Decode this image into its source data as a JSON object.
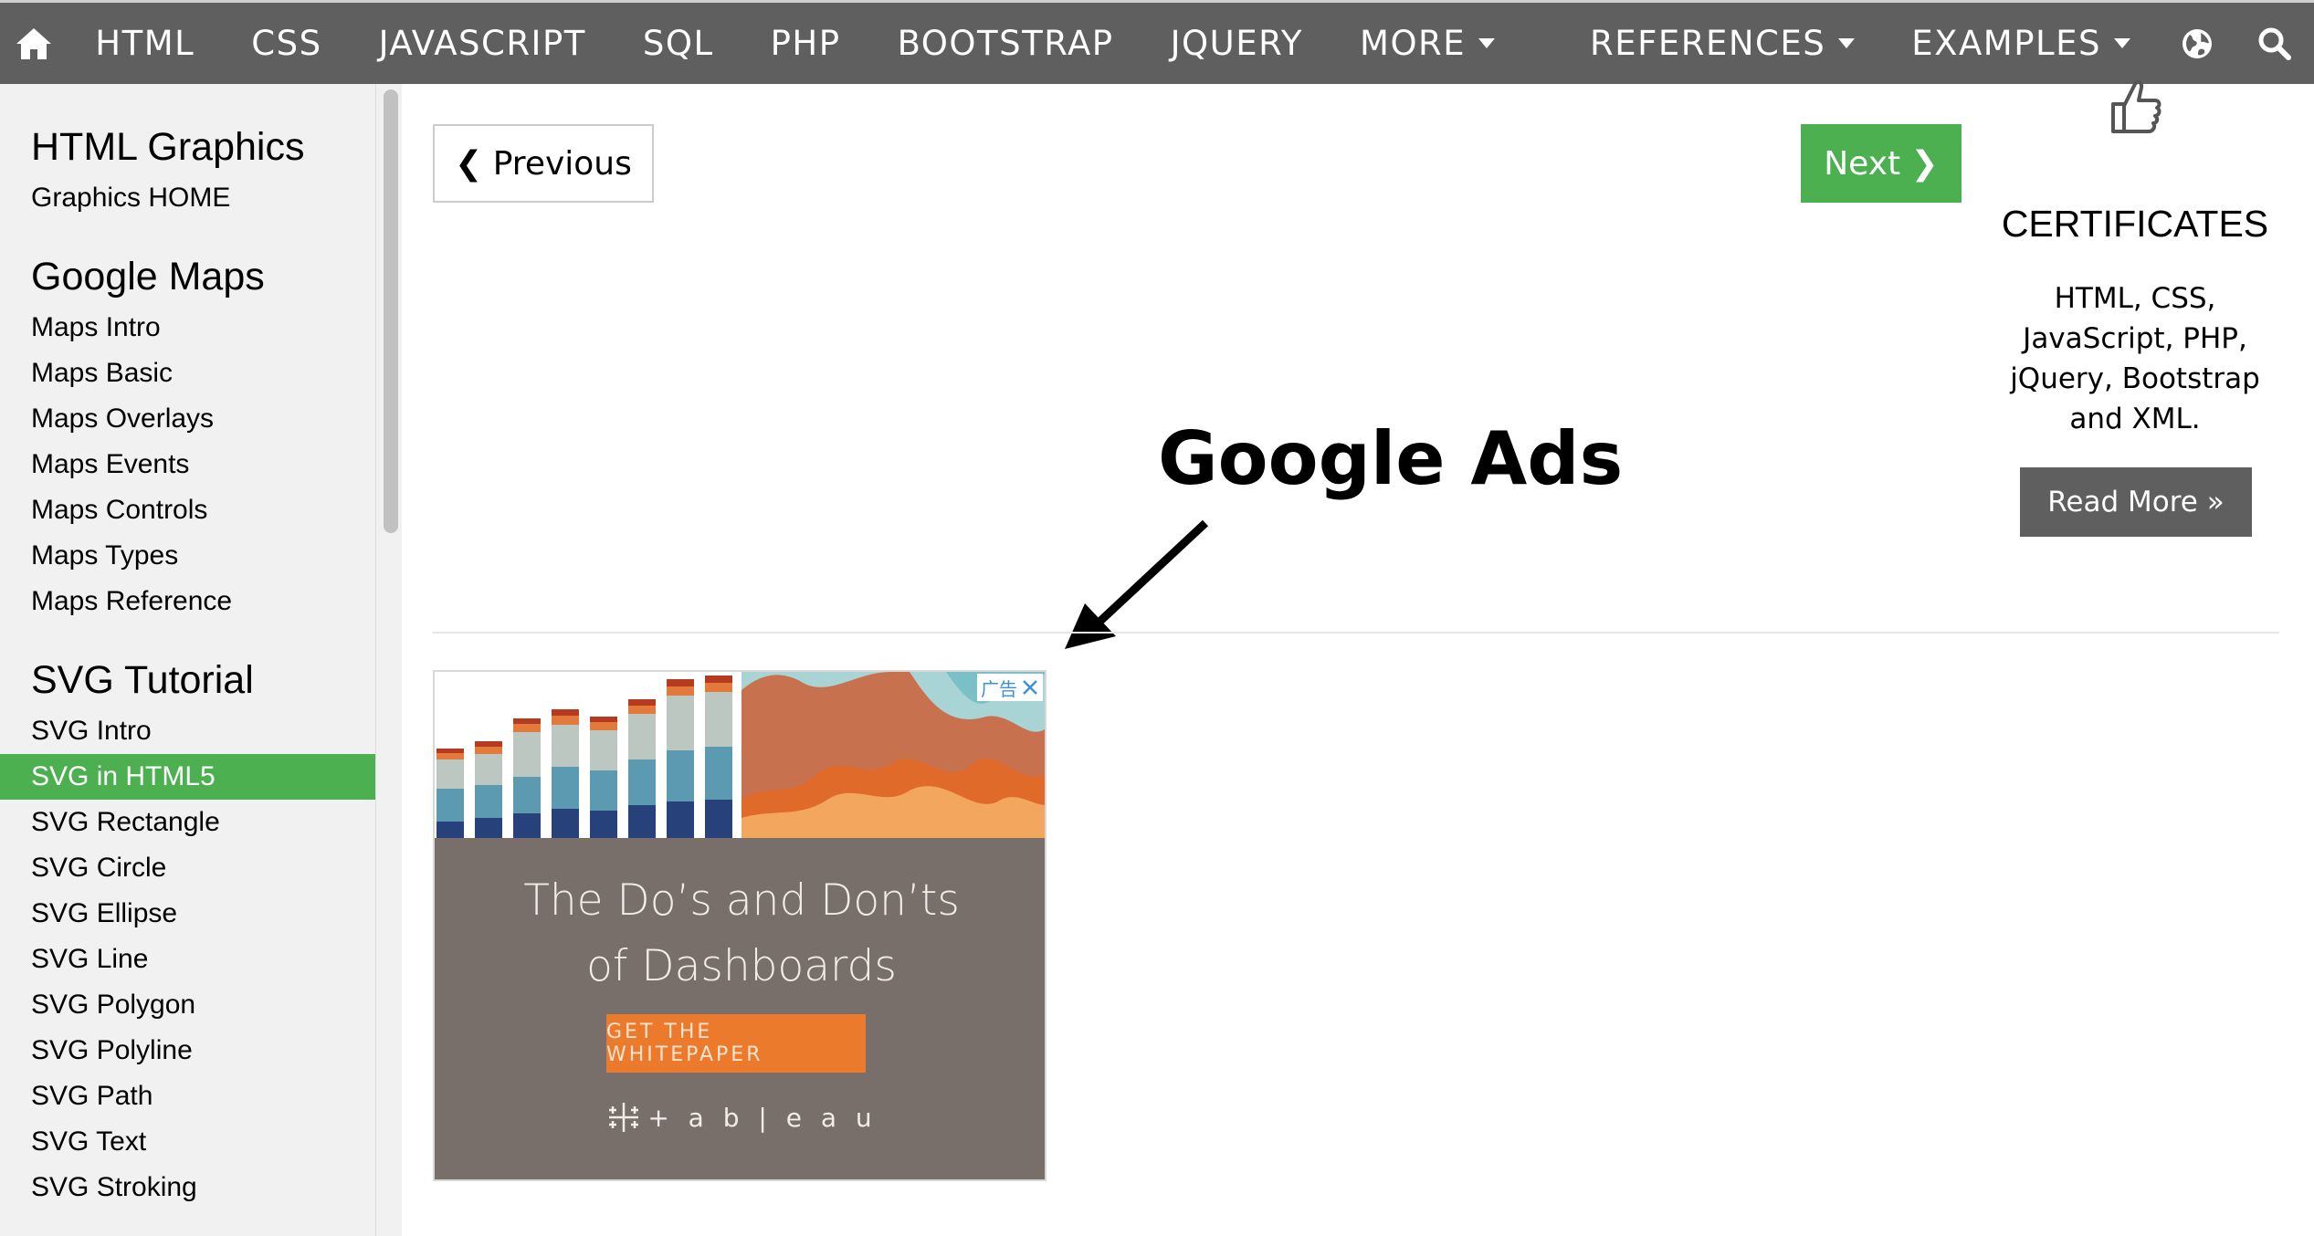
{
  "nav": {
    "items": [
      {
        "label": "HTML",
        "dropdown": false
      },
      {
        "label": "CSS",
        "dropdown": false
      },
      {
        "label": "JAVASCRIPT",
        "dropdown": false
      },
      {
        "label": "SQL",
        "dropdown": false
      },
      {
        "label": "PHP",
        "dropdown": false
      },
      {
        "label": "BOOTSTRAP",
        "dropdown": false
      },
      {
        "label": "JQUERY",
        "dropdown": false
      },
      {
        "label": "MORE",
        "dropdown": true
      },
      {
        "label": "REFERENCES",
        "dropdown": true
      },
      {
        "label": "EXAMPLES",
        "dropdown": true
      }
    ],
    "icons": [
      "home-icon",
      "globe-icon",
      "search-icon"
    ]
  },
  "sidebar": {
    "sections": [
      {
        "heading": "HTML Graphics",
        "items": [
          "Graphics HOME"
        ]
      },
      {
        "heading": "Google Maps",
        "items": [
          "Maps Intro",
          "Maps Basic",
          "Maps Overlays",
          "Maps Events",
          "Maps Controls",
          "Maps Types",
          "Maps Reference"
        ]
      },
      {
        "heading": "SVG Tutorial",
        "items": [
          "SVG Intro",
          "SVG in HTML5",
          "SVG Rectangle",
          "SVG Circle",
          "SVG Ellipse",
          "SVG Line",
          "SVG Polygon",
          "SVG Polyline",
          "SVG Path",
          "SVG Text",
          "SVG Stroking"
        ]
      }
    ],
    "active_item": "SVG in HTML5"
  },
  "pager": {
    "previous_label": "❮ Previous",
    "next_label": "Next ❯"
  },
  "annotation": {
    "label": "Google Ads"
  },
  "ad": {
    "title_line1": "The Do’s and Don’ts",
    "title_line2": "of Dashboards",
    "cta_label": "GET THE WHITEPAPER",
    "brand": "+ a b | e a u",
    "adchoice_label": "广告",
    "close_icon": "close-icon"
  },
  "certificates": {
    "title": "CERTIFICATES",
    "text_lines": [
      "HTML, CSS,",
      "JavaScript, PHP,",
      "jQuery, Bootstrap",
      "and XML."
    ],
    "button_label": "Read More »"
  },
  "colors": {
    "nav_bg": "#5f5f5f",
    "accent_green": "#4caf50",
    "sidebar_bg": "#f1f1f1",
    "ad_bg": "#786e6a",
    "ad_cta": "#eb7a2d"
  }
}
